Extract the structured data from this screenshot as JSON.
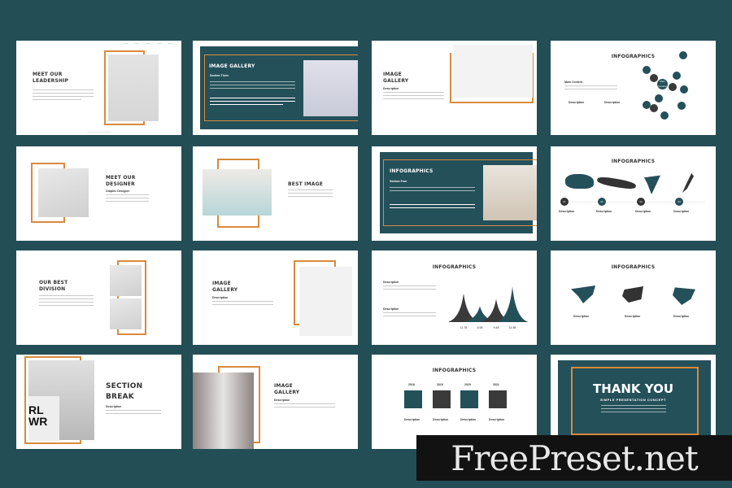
{
  "colors": {
    "background": "#234e56",
    "accent": "#d98a3d",
    "primary": "#24505a",
    "dark": "#3a3a3a"
  },
  "slides": [
    {
      "title_line1": "MEET OUR",
      "title_line2": "LEADERSHIP"
    },
    {
      "title": "IMAGE GALLERY",
      "subtitle": "Section Three"
    },
    {
      "title_line1": "IMAGE",
      "title_line2": "GALLERY",
      "subtitle": "Description"
    },
    {
      "title": "INFOGRAPHICS",
      "heading": "Main Content",
      "center": "Main Content",
      "desc1": "Description",
      "desc2": "Description"
    },
    {
      "title_line1": "MEET OUR",
      "title_line2": "DESIGNER",
      "subtitle": "Graphic Designer"
    },
    {
      "title": "BEST IMAGE"
    },
    {
      "title": "INFOGRAPHICS",
      "subtitle": "Section Four"
    },
    {
      "title": "INFOGRAPHICS",
      "numbers": [
        "01",
        "02",
        "03",
        "04"
      ],
      "labels": [
        "Description",
        "Description",
        "Description",
        "Description"
      ]
    },
    {
      "title_line1": "OUR BEST",
      "title_line2": "DIVISION"
    },
    {
      "title_line1": "IMAGE",
      "title_line2": "GALLERY",
      "subtitle": "Description"
    },
    {
      "title": "INFOGRAPHICS",
      "desc1": "Description",
      "desc2": "Description",
      "chart_labels": [
        "11.78",
        "6.58",
        "9.48",
        "14.58"
      ]
    },
    {
      "title": "INFOGRAPHICS",
      "labels": [
        "Description",
        "Description",
        "Description"
      ]
    },
    {
      "title_line1": "SECTION",
      "title_line2": "BREAK",
      "subtitle": "Description",
      "sign_text": "RL WR"
    },
    {
      "title_line1": "IMAGE",
      "title_line2": "GALLERY",
      "subtitle": "Description"
    },
    {
      "title": "INFOGRAPHICS",
      "years": [
        "2018",
        "2019",
        "2020",
        "2021"
      ],
      "labels": [
        "Description",
        "Description",
        "Description",
        "Description"
      ]
    },
    {
      "title": "THANK YOU",
      "subtitle": "SIMPLE PRESENTATION CONCEPT"
    }
  ],
  "chart_data": {
    "type": "area",
    "categories": [
      "11.78",
      "6.58",
      "9.48",
      "14.58"
    ],
    "values": [
      11.78,
      6.58,
      9.48,
      14.58
    ]
  },
  "watermark": "FreePreset.net"
}
